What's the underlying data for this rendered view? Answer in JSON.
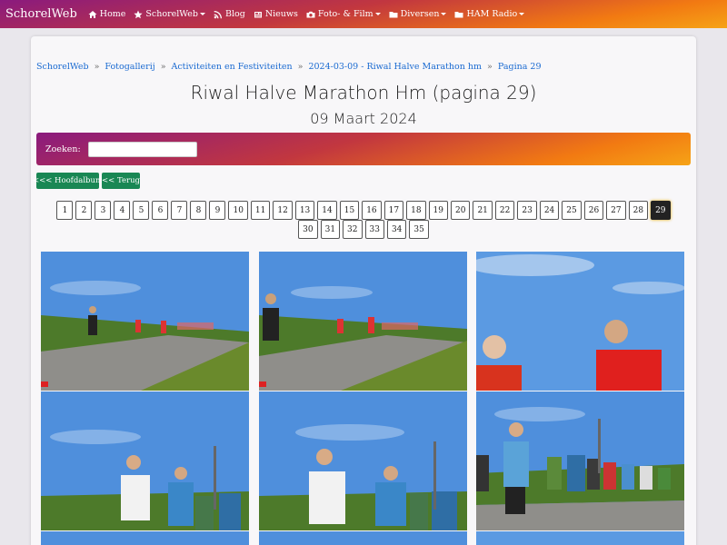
{
  "navbar": {
    "brand": "SchorelWeb",
    "items": [
      {
        "label": "Home",
        "icon": "home-icon",
        "dropdown": false
      },
      {
        "label": "SchorelWeb",
        "icon": "star-icon",
        "dropdown": true
      },
      {
        "label": "Blog",
        "icon": "rss-icon",
        "dropdown": false
      },
      {
        "label": "Nieuws",
        "icon": "newspaper-icon",
        "dropdown": false
      },
      {
        "label": "Foto- & Film",
        "icon": "camera-icon",
        "dropdown": true
      },
      {
        "label": "Diversen",
        "icon": "folder-icon",
        "dropdown": true
      },
      {
        "label": "HAM Radio",
        "icon": "folder-icon",
        "dropdown": true
      }
    ]
  },
  "breadcrumb": [
    "SchorelWeb",
    "Fotogallerij",
    "Activiteiten en Festiviteiten",
    "2024-03-09 - Riwal Halve Marathon hm",
    "Pagina 29"
  ],
  "breadcrumb_separator": "»",
  "page": {
    "title": "Riwal Halve Marathon Hm (pagina 29)",
    "subtitle": "09 Maart 2024"
  },
  "search": {
    "label": "Zoeken:",
    "value": ""
  },
  "buttons": {
    "main_album": "<<< Hoofdalbum",
    "back": "<< Terug"
  },
  "pagination": {
    "row1": [
      "1",
      "2",
      "3",
      "4",
      "5",
      "6",
      "7",
      "8",
      "9",
      "10",
      "11",
      "12",
      "13",
      "14",
      "15",
      "16",
      "17",
      "18",
      "19",
      "20",
      "21",
      "22",
      "23",
      "24",
      "25",
      "26",
      "27",
      "28",
      "29"
    ],
    "row2": [
      "30",
      "31",
      "32",
      "33",
      "34",
      "35"
    ],
    "current": "29"
  },
  "colors": {
    "accent_start": "#8a1a7e",
    "accent_end": "#f6a316",
    "link": "#1a6ad1",
    "button_green": "#198754"
  }
}
